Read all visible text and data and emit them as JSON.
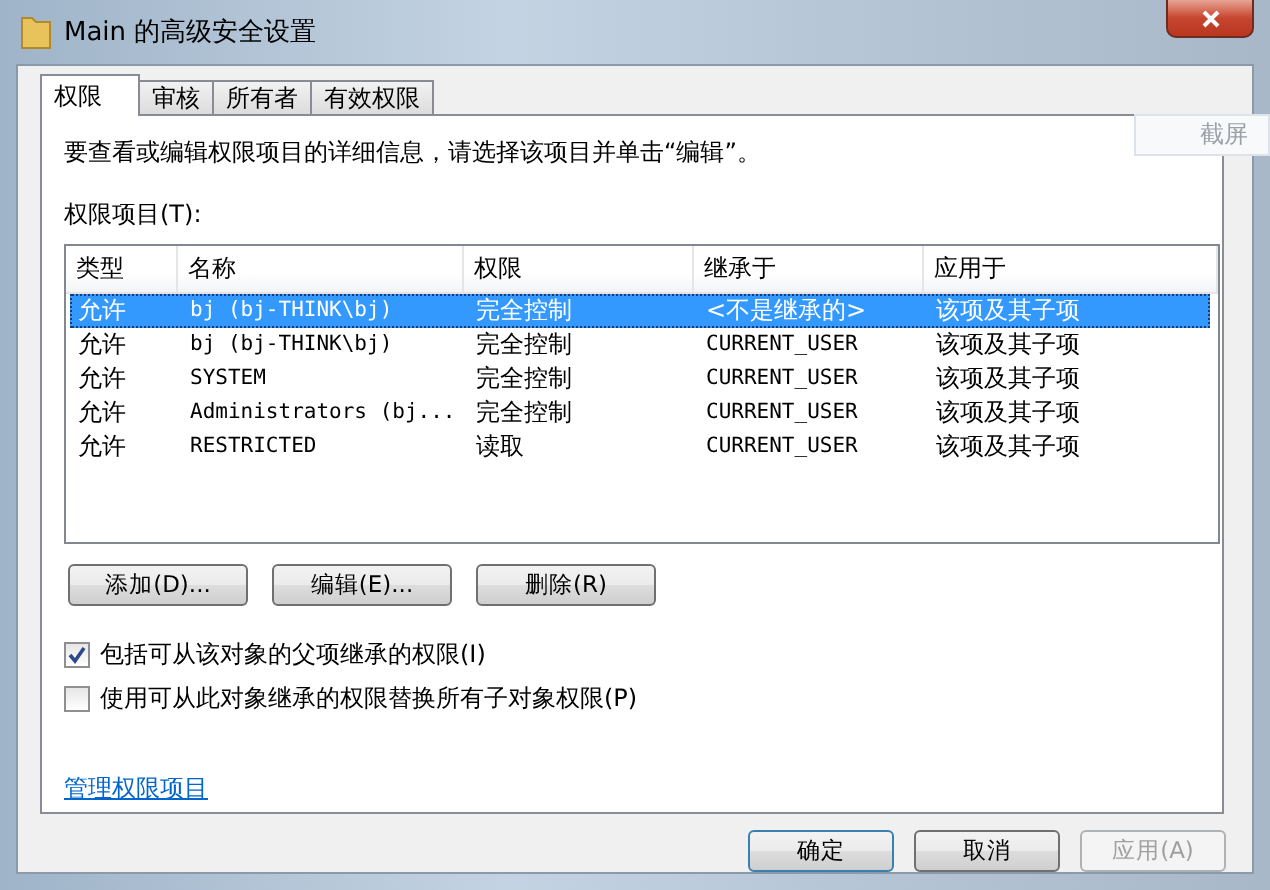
{
  "window": {
    "title": "Main 的高级安全设置"
  },
  "tabs": [
    {
      "label": "权限",
      "selected": true
    },
    {
      "label": "审核",
      "selected": false
    },
    {
      "label": "所有者",
      "selected": false
    },
    {
      "label": "有效权限",
      "selected": false
    }
  ],
  "overlay_button": "截屏",
  "instruction": "要查看或编辑权限项目的详细信息，请选择该项目并单击“编辑”。",
  "list_label": "权限项目(T):",
  "table": {
    "columns": [
      "类型",
      "名称",
      "权限",
      "继承于",
      "应用于"
    ],
    "rows": [
      {
        "cells": [
          "允许",
          "bj (bj-THINK\\bj)",
          "完全控制",
          "<不是继承的>",
          "该项及其子项"
        ],
        "selected": true
      },
      {
        "cells": [
          "允许",
          "bj (bj-THINK\\bj)",
          "完全控制",
          "CURRENT_USER",
          "该项及其子项"
        ],
        "selected": false
      },
      {
        "cells": [
          "允许",
          "SYSTEM",
          "完全控制",
          "CURRENT_USER",
          "该项及其子项"
        ],
        "selected": false
      },
      {
        "cells": [
          "允许",
          "Administrators (bj...",
          "完全控制",
          "CURRENT_USER",
          "该项及其子项"
        ],
        "selected": false
      },
      {
        "cells": [
          "允许",
          "RESTRICTED",
          "读取",
          "CURRENT_USER",
          "该项及其子项"
        ],
        "selected": false
      }
    ]
  },
  "actions": [
    "添加(D)...",
    "编辑(E)...",
    "删除(R)"
  ],
  "checkboxes": [
    {
      "label": "包括可从该对象的父项继承的权限(I)",
      "checked": true
    },
    {
      "label": "使用可从此对象继承的权限替换所有子对象权限(P)",
      "checked": false
    }
  ],
  "link": "管理权限项目",
  "buttons": [
    {
      "label": "确定",
      "disabled": false
    },
    {
      "label": "取消",
      "disabled": false
    },
    {
      "label": "应用(A)",
      "disabled": true
    }
  ]
}
